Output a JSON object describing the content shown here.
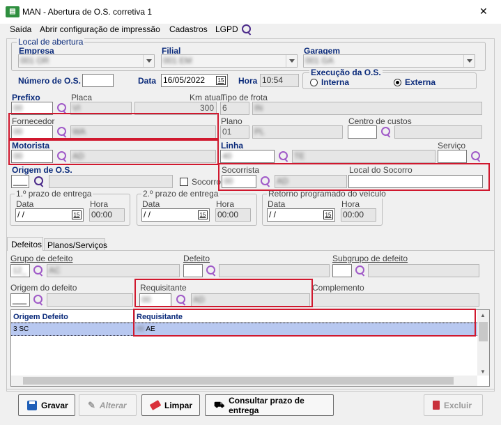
{
  "window": {
    "app_code": "MAN",
    "title": "MAN - Abertura de O.S. corretiva 1",
    "close": "✕"
  },
  "menu": {
    "sair": "Saída",
    "imprimir": "Abrir configuração de impressão",
    "cadastros": "Cadastros",
    "lgpd": "LGPD"
  },
  "local": {
    "legend": "Local de abertura",
    "empresa_label": "Empresa",
    "empresa_value": "001 OR",
    "filial_label": "Filial",
    "filial_value": "001 EM",
    "garagem_label": "Garagem",
    "garagem_value": "001 GA"
  },
  "os": {
    "numero_label": "Número de O.S.",
    "numero_value": "",
    "data_label": "Data",
    "data_value": "16/05/2022",
    "hora_label": "Hora",
    "hora_value": "10:54",
    "execucao_legend": "Execução da O.S.",
    "interna": "Interna",
    "externa": "Externa",
    "selected": "Externa"
  },
  "veiculo": {
    "prefixo_label": "Prefixo",
    "prefixo_value": "00",
    "placa_label": "Placa",
    "placa_value": "VI",
    "km_label": "Km atual",
    "km_value": "300",
    "tipo_frota_label": "Tipo de frota",
    "tipo_frota_code": "6",
    "tipo_frota_value": "IN"
  },
  "fornecedor": {
    "label": "Fornecedor",
    "code": "00",
    "name": "WA"
  },
  "plano": {
    "label": "Plano",
    "code": "01",
    "name": "PL"
  },
  "centro": {
    "label": "Centro de custos"
  },
  "motorista": {
    "label": "Motorista",
    "code": "00",
    "name": "AD"
  },
  "linha": {
    "label": "Linha",
    "code": "40",
    "name": "TE"
  },
  "servico": {
    "label": "Serviço"
  },
  "origem_os": {
    "label": "Origem de O.S.",
    "value": "___"
  },
  "socorro": {
    "label": "Socorro",
    "socorrista_label": "Socorrista",
    "socorrista_code": "00",
    "socorrista_name": "AD",
    "local_label": "Local do Socorro",
    "local_value": ""
  },
  "prazos": [
    {
      "legend": "1.º prazo de entrega",
      "data_label": "Data",
      "data_value": " / /",
      "hora_label": "Hora",
      "hora_value": "00:00"
    },
    {
      "legend": "2.º prazo de entrega",
      "data_label": "Data",
      "data_value": " / /",
      "hora_label": "Hora",
      "hora_value": "00:00"
    },
    {
      "legend": "Retorno programado do veículo",
      "data_label": "Data",
      "data_value": " / /",
      "hora_label": "Hora",
      "hora_value": "00:00"
    }
  ],
  "tabs": {
    "defeitos": "Defeitos",
    "planos": "Planos/Serviços"
  },
  "defeitos": {
    "grupo_label": "Grupo de defeito",
    "grupo_code": "12_",
    "grupo_name": "AC",
    "defeito_label": "Defeito",
    "subgrupo_label": "Subgrupo de defeito",
    "origem_label": "Origem do defeito",
    "origem_value": "___",
    "requisitante_label": "Requisitante",
    "requisitante_code": "00",
    "requisitante_name": "AD",
    "complemento_label": "Complemento"
  },
  "grid": {
    "headers": [
      "Origem Defeito",
      "Requisitante"
    ],
    "rows": [
      {
        "origem": "3 SC",
        "requisitante": "00",
        "req_name": "AE"
      }
    ]
  },
  "buttons": {
    "gravar": "Gravar",
    "alterar": "Alterar",
    "limpar": "Limpar",
    "consultar": "Consultar prazo de entrega",
    "excluir": "Excluir"
  },
  "calendar_glyph": "15",
  "colors": {
    "highlight": "#d0182e",
    "label_blue": "#0a2a7a",
    "selection": "#b8c8f0"
  }
}
